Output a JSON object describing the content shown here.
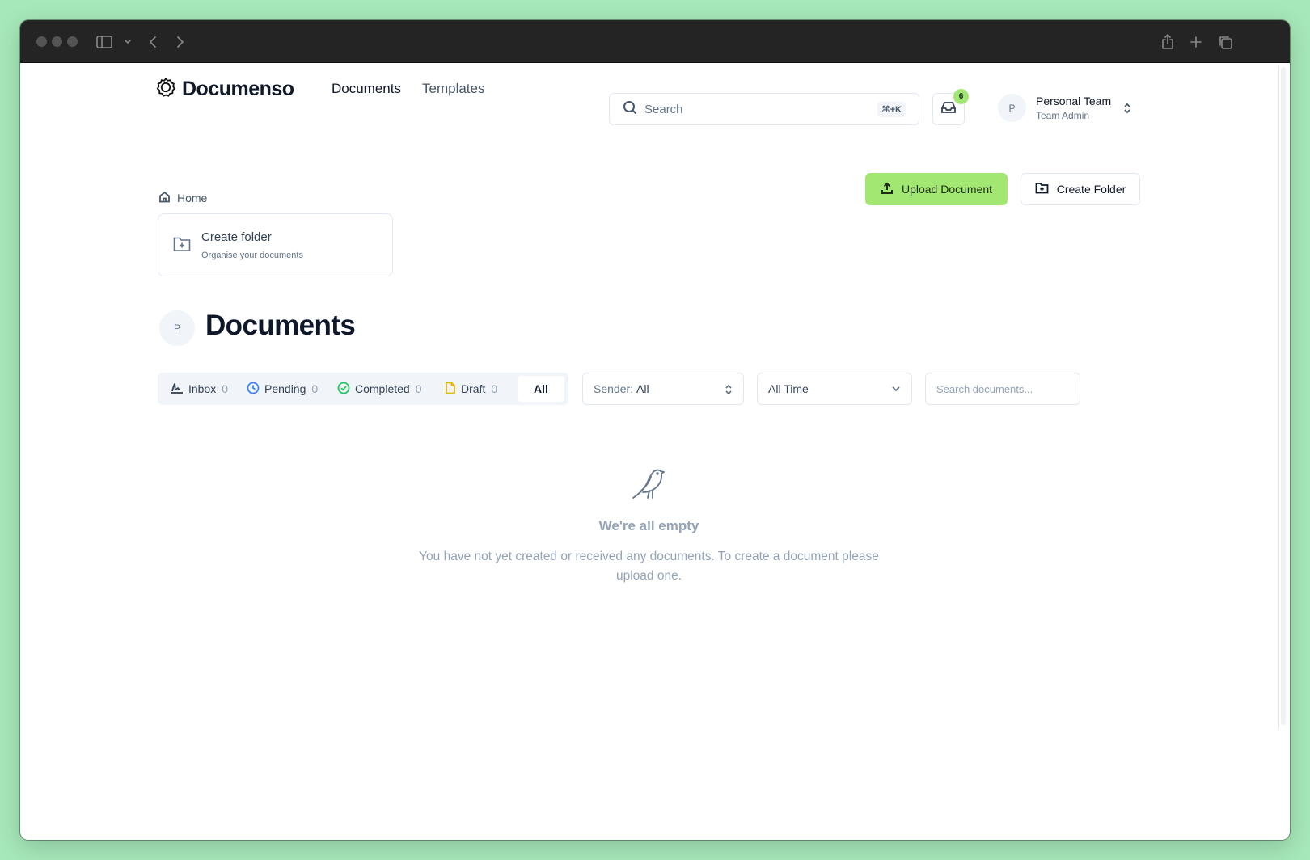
{
  "header": {
    "logo_text": "Documenso",
    "nav": {
      "documents": "Documents",
      "templates": "Templates"
    },
    "search": {
      "placeholder": "Search",
      "shortcut": "⌘+K"
    },
    "inbox_badge": "6",
    "team": {
      "avatar_initial": "P",
      "name": "Personal Team",
      "role": "Team Admin"
    }
  },
  "toolbar": {
    "breadcrumb_home": "Home",
    "upload_label": "Upload Document",
    "create_folder_label": "Create Folder"
  },
  "folder_card": {
    "title": "Create folder",
    "subtitle": "Organise your documents"
  },
  "page": {
    "avatar_initial": "P",
    "title": "Documents"
  },
  "tabs": [
    {
      "label": "Inbox",
      "count": "0",
      "icon": "signature-icon"
    },
    {
      "label": "Pending",
      "count": "0",
      "icon": "clock-icon"
    },
    {
      "label": "Completed",
      "count": "0",
      "icon": "check-circle-icon"
    },
    {
      "label": "Draft",
      "count": "0",
      "icon": "file-icon"
    },
    {
      "label": "All",
      "active": true
    }
  ],
  "filters": {
    "sender_label": "Sender:",
    "sender_value": "All",
    "period_value": "All Time",
    "search_placeholder": "Search documents..."
  },
  "empty_state": {
    "icon": "bird-icon",
    "title": "We're all empty",
    "message": "You have not yet created or received any documents. To create a document please upload one."
  },
  "colors": {
    "accent": "#a2e771",
    "background": "#a6e8b9",
    "titlebar": "#242424",
    "pending_icon": "#3b82f6",
    "completed_icon": "#22c55e",
    "draft_icon": "#eab308"
  }
}
